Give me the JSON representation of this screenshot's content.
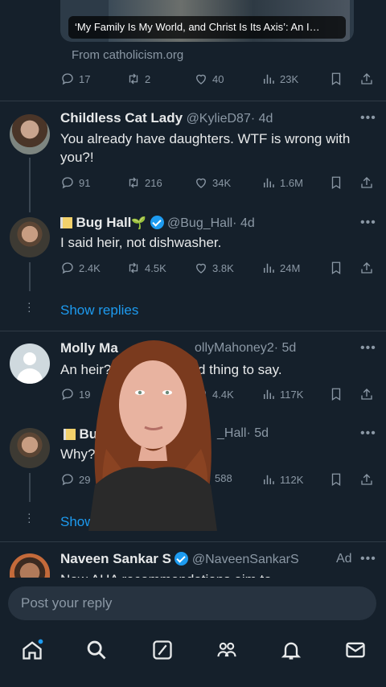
{
  "link_card": {
    "caption": "‘My Family Is My World, and Christ Is Its Axis’: An I…",
    "source": "From catholicism.org"
  },
  "tweet0": {
    "replies": "17",
    "retweets": "2",
    "likes": "40",
    "views": "23K"
  },
  "tweet1": {
    "name": "Childless Cat Lady",
    "handle": "@KylieD87",
    "time": "· 4d",
    "text": "You already have daughters. WTF is wrong with you?!",
    "replies": "91",
    "retweets": "216",
    "likes": "34K",
    "views": "1.6M"
  },
  "tweet2": {
    "name": "Bug Hall",
    "sprout": "🌱",
    "handle": "@Bug_Hall",
    "time": "· 4d",
    "text": "I said heir, not dishwasher.",
    "replies": "2.4K",
    "retweets": "4.5K",
    "likes": "3.8K",
    "views": "24M"
  },
  "show_replies_label": "Show replies",
  "tweet3": {
    "name": "Molly Ma",
    "handle": "ollyMahoney2",
    "time": "· 5d",
    "text_a": "An heir?",
    "text_b": "d thing to say.",
    "replies": "19",
    "likes": "4.4K",
    "views": "117K"
  },
  "tweet4": {
    "name": "Bu",
    "handle": "_Hall",
    "time": "· 5d",
    "text": "Why?",
    "replies": "29",
    "likes": "588",
    "views": "112K"
  },
  "show_replies_partial": "Show replies",
  "ad": {
    "name": "Naveen Sankar S",
    "handle": "@NaveenSankarS",
    "label": "Ad",
    "text": "New AHA recommendations aim to"
  },
  "reply_placeholder": "Post your reply",
  "nav": [
    "home-icon",
    "search-icon",
    "grok-icon",
    "communities-icon",
    "notifications-icon",
    "messages-icon"
  ],
  "colors": {
    "background": "#15202b",
    "accent": "#1d9bf0",
    "muted": "#8b98a5"
  }
}
